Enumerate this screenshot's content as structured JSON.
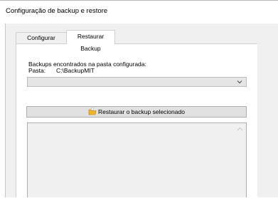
{
  "window": {
    "title": "Configuração de backup e restore"
  },
  "tabs": [
    {
      "label": "Configurar Backup",
      "active": false
    },
    {
      "label": "Restaurar Backup",
      "active": true
    }
  ],
  "restore": {
    "found_label": "Backups encontrados na pasta configurada:",
    "folder_label": "Pasta:",
    "folder_value": "C:\\BackupMIT",
    "backup_select_value": "",
    "restore_button_label": "Restaurar o backup selecionado"
  },
  "icons": {
    "combo_arrow": "chevron-down-icon",
    "restore_button": "folder-restore-icon",
    "list_scroll_up": "chevron-up-icon"
  },
  "colors": {
    "panel_bg": "#f0f0f0",
    "button_face": "#e1e1e1",
    "folder_icon": "#f0b429"
  }
}
